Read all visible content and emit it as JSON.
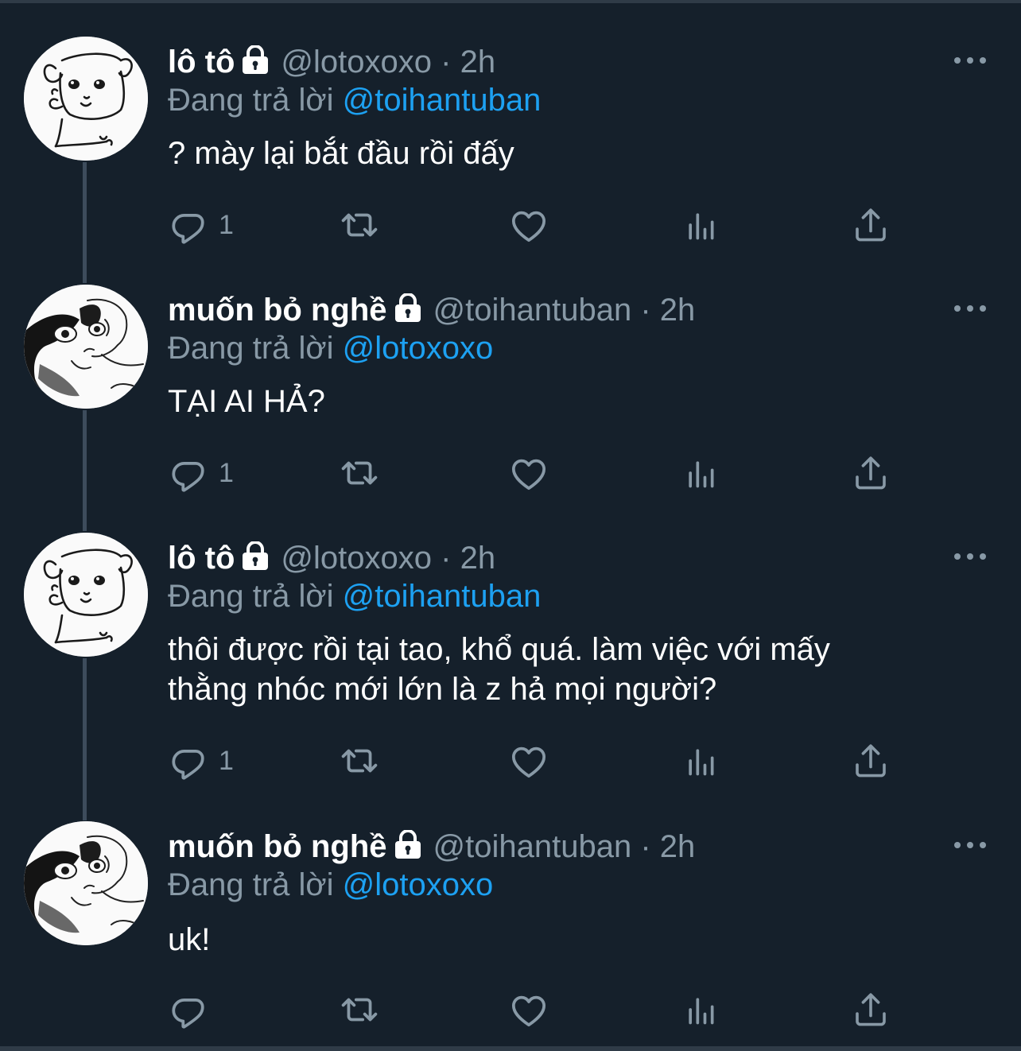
{
  "tweets": [
    {
      "name": "lô tô",
      "handle": "@lotoxoxo",
      "dot": "·",
      "time": "2h",
      "replying_prefix": "Đang trả lời",
      "replying_to": "@toihantuban",
      "text": "? mày lại bắt đầu rồi đấy",
      "reply_count": "1",
      "avatar": "dog-drawing"
    },
    {
      "name": "muốn bỏ nghề",
      "handle": "@toihantuban",
      "dot": "·",
      "time": "2h",
      "replying_prefix": "Đang trả lời",
      "replying_to": "@lotoxoxo",
      "text": "TẠI AI HẢ?",
      "reply_count": "1",
      "avatar": "boy-sketch"
    },
    {
      "name": "lô tô",
      "handle": "@lotoxoxo",
      "dot": "·",
      "time": "2h",
      "replying_prefix": "Đang trả lời",
      "replying_to": "@toihantuban",
      "text_line1": "thôi được rồi tại tao, khổ quá. làm việc với mấy",
      "text_line2": "thằng nhóc mới lớn là z hả mọi người?",
      "reply_count": "1",
      "avatar": "dog-drawing"
    },
    {
      "name": "muốn bỏ nghề",
      "handle": "@toihantuban",
      "dot": "·",
      "time": "2h",
      "replying_prefix": "Đang trả lời",
      "replying_to": "@lotoxoxo",
      "text": "uk!",
      "reply_count": "",
      "avatar": "boy-sketch"
    }
  ],
  "icons": {
    "reply": "reply-icon",
    "retweet": "retweet-icon",
    "like": "like-icon",
    "analytics": "analytics-icon",
    "share": "share-icon",
    "more": "more-icon",
    "lock": "lock-icon"
  },
  "colors": {
    "background": "#15202b",
    "text": "#ffffff",
    "secondary": "#8899a6",
    "link": "#1da1f2",
    "thread_line": "#3d4c5c"
  }
}
